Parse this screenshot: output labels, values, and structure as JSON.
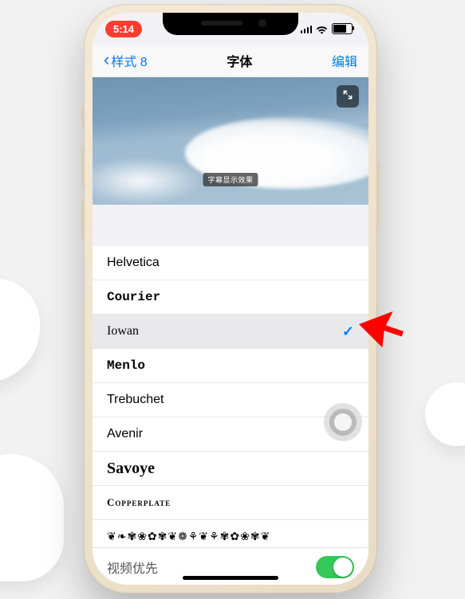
{
  "status": {
    "time": "5:14"
  },
  "nav": {
    "back_label": "样式 8",
    "title": "字体",
    "edit_label": "编辑"
  },
  "preview": {
    "caption": "字幕显示效果"
  },
  "fonts": {
    "items": [
      {
        "label": "Helvetica"
      },
      {
        "label": "Courier"
      },
      {
        "label": "Iowan"
      },
      {
        "label": "Menlo"
      },
      {
        "label": "Trebuchet"
      },
      {
        "label": "Avenir"
      },
      {
        "label": "Savoye"
      },
      {
        "label": "Copperplate"
      },
      {
        "label": "❦❧✾❀✿✾❦❁⚘❦⚘✾✿❀✾❦"
      }
    ],
    "selected_index": 2
  },
  "toggle": {
    "label": "视频优先",
    "on": true
  },
  "colors": {
    "accent": "#007aff",
    "switch_on": "#34c759",
    "pointer": "#ff0000",
    "time_bg": "#ff3b30"
  }
}
